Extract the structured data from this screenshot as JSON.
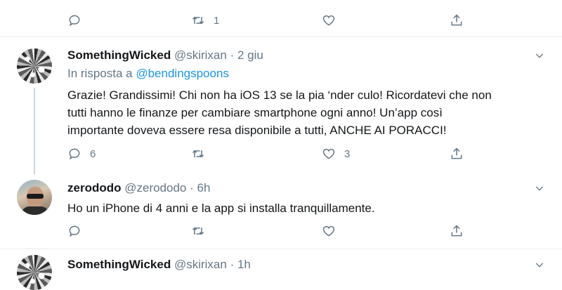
{
  "top_tweet": {
    "retweet_count": "1"
  },
  "tweets": [
    {
      "name": "SomethingWicked",
      "handle": "@skirixan",
      "separator": "·",
      "time": "2 giu",
      "reply_prefix": "In risposta a",
      "reply_mention": "@bendingspoons",
      "text_lines": [
        "Grazie! Grandissimi! Chi non ha iOS 13 se la pia ‘nder culo! Ricordatevi che non",
        "tutti hanno le finanze per cambiare smartphone ogni anno! Un’app così",
        "importante doveva essere resa disponibile a tutti, ANCHE AI PORACCI!"
      ],
      "reply_count": "6",
      "retweet_count": "",
      "like_count": "3"
    },
    {
      "name": "zerododo",
      "handle": "@zerododo",
      "separator": "·",
      "time": "6h",
      "text_lines": [
        "Ho un iPhone di 4 anni e la app si installa tranquillamente."
      ],
      "reply_count": "",
      "retweet_count": "",
      "like_count": ""
    },
    {
      "name": "SomethingWicked",
      "handle": "@skirixan",
      "separator": "·",
      "time": "1h"
    }
  ],
  "icons": {
    "reply": "reply-icon",
    "retweet": "retweet-icon",
    "like": "heart-icon",
    "share": "share-icon",
    "more": "chevron-down-icon"
  },
  "colors": {
    "link": "#1b95e0",
    "muted": "#657786",
    "divider": "#e6ecf0"
  }
}
